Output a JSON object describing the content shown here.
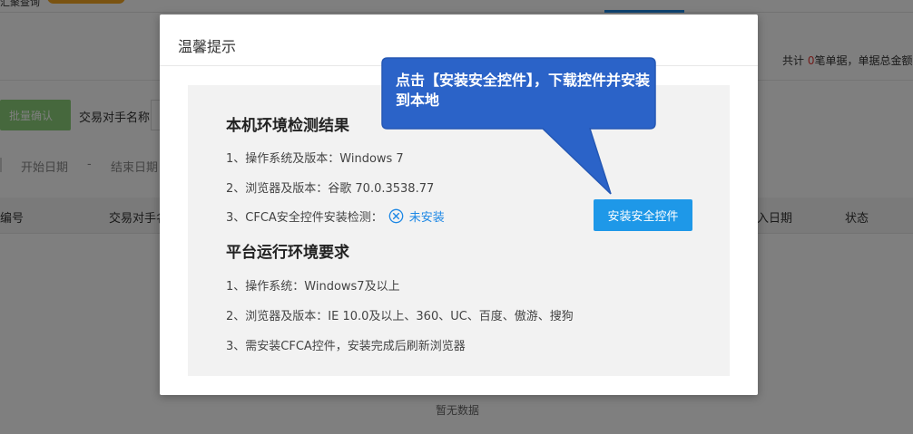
{
  "background": {
    "brand_fragment": "汇聚查询",
    "summary": {
      "prefix": "共计 ",
      "count": "0",
      "suffix": "笔单据，单据总金额"
    },
    "batch_confirm_label": "批量确认",
    "counterparty_label": "交易对手名称",
    "start_date_label": "开始日期",
    "date_dash": "-",
    "end_date_label": "结束日期",
    "table_headers": [
      "编号",
      "交易对手名",
      "入日期",
      "状态"
    ],
    "empty_text": "暂无数据"
  },
  "dialog": {
    "title": "温馨提示",
    "env_title": "本机环境检测结果",
    "env_items": [
      "1、操作系统及版本：Windows 7",
      "2、浏览器及版本：谷歌 70.0.3538.77"
    ],
    "cfca_check_label": "3、CFCA安全控件安装检测：",
    "cfca_status": "未安装",
    "install_button_label": "安装安全控件",
    "req_title": "平台运行环境要求",
    "req_items": [
      "1、操作系统：Windows7及以上",
      "2、浏览器及版本：IE 10.0及以上、360、UC、百度、傲游、搜狗",
      "3、需安装CFCA控件，安装完成后刷新浏览器"
    ]
  },
  "callout": {
    "text": "点击【安装安全控件】，下载控件并安装到本地",
    "fill_color": "#2b63c8",
    "stroke_color": "#2457b4"
  },
  "colors": {
    "accent_blue": "#1e98e8",
    "status_blue": "#1e88e5",
    "batch_green": "#8cd17a",
    "count_red": "#e53935"
  }
}
